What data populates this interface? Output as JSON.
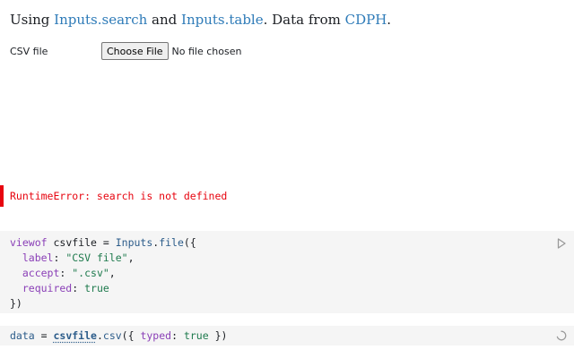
{
  "intro": {
    "t1": "Using ",
    "link_search": "Inputs.search",
    "t2": " and ",
    "link_table": "Inputs.table",
    "t3": ". Data from ",
    "link_cdph": "CDPH",
    "t4": "."
  },
  "file_input": {
    "label": "CSV file",
    "button_label": "Choose File",
    "status": "No file chosen"
  },
  "error": {
    "message": "RuntimeError: search is not defined"
  },
  "cell1": {
    "l1": {
      "a": "viewof",
      "b": " csvfile = ",
      "c": "Inputs",
      "d": ".",
      "e": "file",
      "f": "({"
    },
    "l2": {
      "a": "  label",
      "b": ": ",
      "c": "\"CSV file\"",
      "d": ","
    },
    "l3": {
      "a": "  accept",
      "b": ": ",
      "c": "\".csv\"",
      "d": ","
    },
    "l4": {
      "a": "  required",
      "b": ": ",
      "c": "true"
    },
    "l5": {
      "a": "})"
    }
  },
  "cell2": {
    "a": "data",
    "b": " = ",
    "c": "csvfile",
    "d": ".",
    "e": "csv",
    "f": "({ ",
    "g": "typed",
    "h": ": ",
    "i": "true",
    "j": " })"
  },
  "icons": {
    "run": "play-icon",
    "pending": "spinner-icon"
  },
  "colors": {
    "error": "#e7040f",
    "link": "#2e7bb8",
    "code_bg": "#f5f5f5"
  }
}
